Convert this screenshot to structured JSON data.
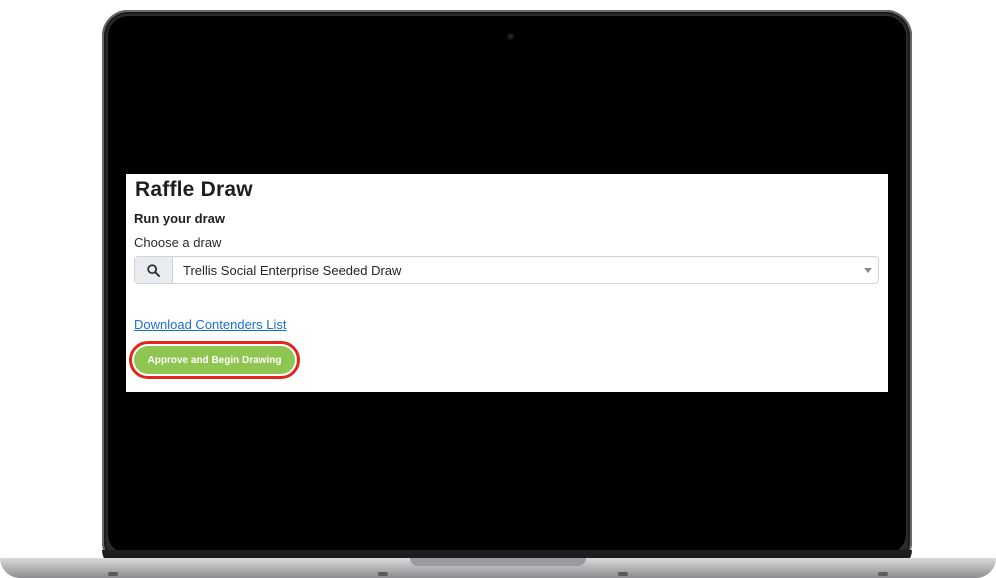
{
  "app": {
    "title": "Raffle Draw",
    "section_title": "Run your draw",
    "draw_select": {
      "label": "Choose a draw",
      "icon": "search-icon",
      "selected_value": "Trellis Social Enterprise Seeded Draw"
    },
    "download_link_label": "Download Contenders List",
    "approve_button_label": "Approve and Begin Drawing"
  },
  "colors": {
    "approve_button": "#8fc551",
    "highlight_ring": "#e3261d",
    "link": "#1a6fd1"
  }
}
